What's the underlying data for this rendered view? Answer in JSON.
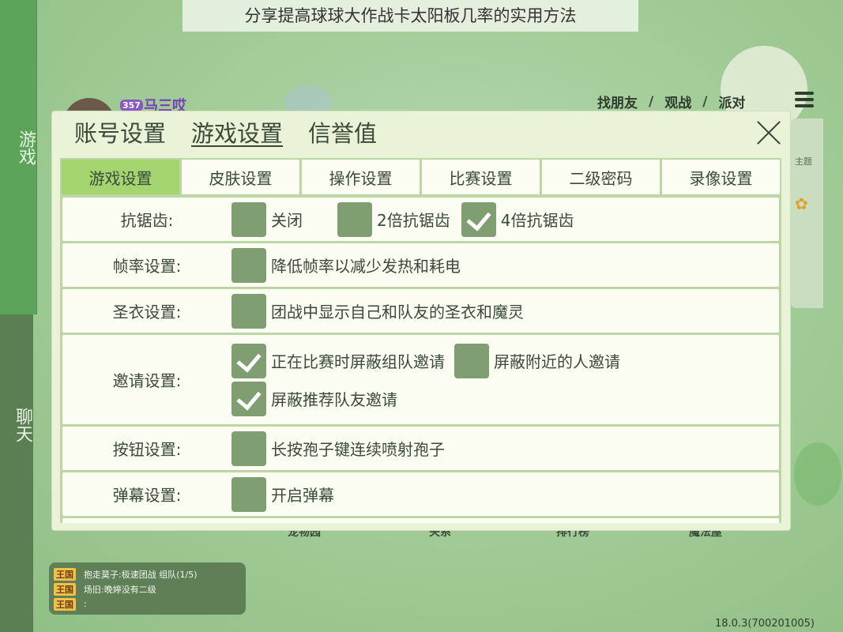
{
  "caption": "分享提高球球大作战卡太阳板几率的实用方法",
  "sidebar": {
    "game_tab": "游戏",
    "chat_tab": "聊天"
  },
  "profile": {
    "level": "357",
    "name": "马三哎"
  },
  "top_nav": {
    "items": [
      "找朋友",
      "观战",
      "派对"
    ],
    "separator": "/"
  },
  "right_panel": {
    "text": "主题"
  },
  "bottom_menu": [
    "宠物园",
    "关系",
    "排行榜",
    "魔法屋"
  ],
  "chat": {
    "lines": [
      {
        "tag": "王国",
        "text": "抱走莫子:极速团战 组队(1/5)"
      },
      {
        "tag": "王国",
        "text": "场旧:晚婷没有二级"
      },
      {
        "tag": "王国",
        "text": ":"
      }
    ]
  },
  "version": "18.0.3(700201005)",
  "modal": {
    "tabs": [
      "账号设置",
      "游戏设置",
      "信誉值"
    ],
    "active_tab": "游戏设置",
    "subtabs": [
      "游戏设置",
      "皮肤设置",
      "操作设置",
      "比赛设置",
      "二级密码",
      "录像设置"
    ],
    "active_subtab": "游戏设置",
    "settings": [
      {
        "label": "抗锯齿:",
        "options": [
          {
            "label": "关闭",
            "checked": false
          },
          {
            "label": "2倍抗锯齿",
            "checked": false
          },
          {
            "label": "4倍抗锯齿",
            "checked": true
          }
        ]
      },
      {
        "label": "帧率设置:",
        "options": [
          {
            "label": "降低帧率以减少发热和耗电",
            "checked": false
          }
        ]
      },
      {
        "label": "圣衣设置:",
        "options": [
          {
            "label": "团战中显示自己和队友的圣衣和魔灵",
            "checked": false
          }
        ]
      },
      {
        "label": "邀请设置:",
        "options": [
          {
            "label": "正在比赛时屏蔽组队邀请",
            "checked": true
          },
          {
            "label": "屏蔽附近的人邀请",
            "checked": false
          },
          {
            "label": "屏蔽推荐队友邀请",
            "checked": true
          }
        ]
      },
      {
        "label": "按钮设置:",
        "options": [
          {
            "label": "长按孢子键连续喷射孢子",
            "checked": false
          }
        ]
      },
      {
        "label": "弹幕设置:",
        "options": [
          {
            "label": "开启弹幕",
            "checked": false
          }
        ]
      }
    ]
  },
  "colors": {
    "accent_green": "#a3d46f",
    "checkbox": "#7f9e72",
    "side_tab": "#5ca45a"
  }
}
